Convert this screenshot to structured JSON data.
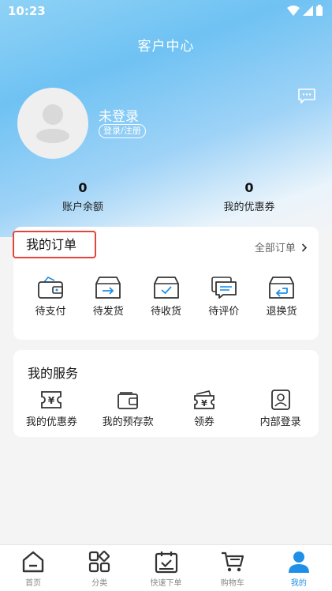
{
  "status": {
    "time": "10:23"
  },
  "header": {
    "title": "客户中心"
  },
  "profile": {
    "name": "未登录",
    "login_label": "登录/注册"
  },
  "balances": [
    {
      "value": "0",
      "label": "账户余额"
    },
    {
      "value": "0",
      "label": "我的优惠券"
    }
  ],
  "orders": {
    "title": "我的订单",
    "all_label": "全部订单",
    "items": [
      {
        "label": "待支付",
        "icon": "wallet-icon"
      },
      {
        "label": "待发货",
        "icon": "box-arrow-icon"
      },
      {
        "label": "待收货",
        "icon": "box-check-icon"
      },
      {
        "label": "待评价",
        "icon": "comment-icon"
      },
      {
        "label": "退换货",
        "icon": "box-return-icon"
      }
    ]
  },
  "services": {
    "title": "我的服务",
    "items": [
      {
        "label": "我的优惠券",
        "icon": "coupon-icon"
      },
      {
        "label": "我的预存款",
        "icon": "wallet-icon"
      },
      {
        "label": "领券",
        "icon": "coupon-stack-icon"
      },
      {
        "label": "内部登录",
        "icon": "user-card-icon"
      }
    ]
  },
  "tabbar": [
    {
      "label": "首页",
      "icon": "home-icon"
    },
    {
      "label": "分类",
      "icon": "category-icon"
    },
    {
      "label": "快速下单",
      "icon": "calendar-check-icon"
    },
    {
      "label": "购物车",
      "icon": "cart-icon"
    },
    {
      "label": "我的",
      "icon": "user-icon"
    }
  ],
  "colors": {
    "accent": "#1e90e8",
    "highlight_border": "#e2453c",
    "icon_stroke": "#333333"
  }
}
